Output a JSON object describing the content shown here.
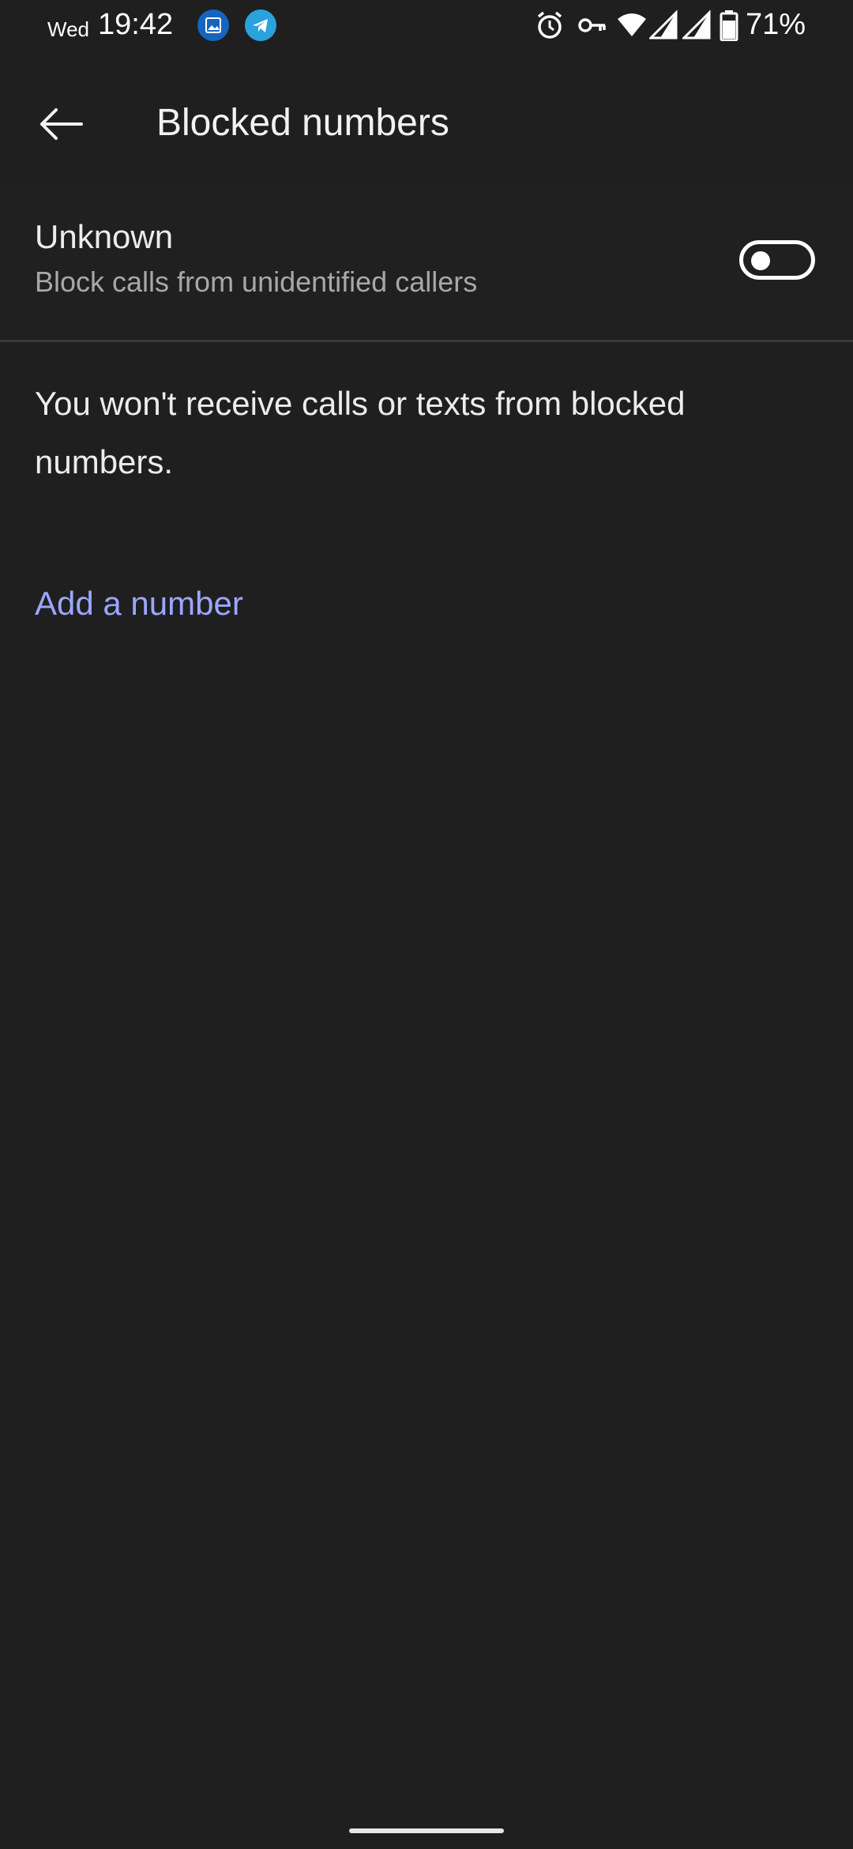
{
  "status_bar": {
    "day": "Wed",
    "time": "19:42",
    "battery_percent": "71%",
    "notification_icons": [
      "gallery-icon",
      "telegram-icon"
    ],
    "system_icons": [
      "alarm-icon",
      "vpn-key-icon",
      "wifi-icon",
      "signal-icon",
      "signal-icon",
      "battery-icon"
    ]
  },
  "app_bar": {
    "title": "Blocked numbers",
    "back_icon": "arrow-left-icon"
  },
  "unknown_setting": {
    "title": "Unknown",
    "subtitle": "Block calls from unidentified callers",
    "toggle_on": false
  },
  "info": {
    "text": "You won't receive calls or texts from blocked numbers."
  },
  "actions": {
    "add_number_label": "Add a number"
  },
  "colors": {
    "background": "#1f1f1f",
    "accent": "#9aa7ff",
    "secondary_text": "#a8a8a8"
  }
}
